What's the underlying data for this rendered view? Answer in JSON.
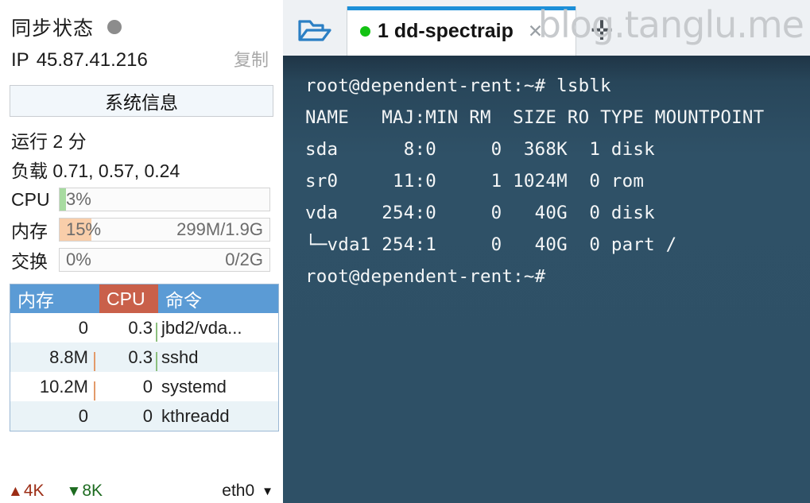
{
  "sidebar": {
    "sync": {
      "label": "同步状态",
      "status_color": "#8c8c8c",
      "indicator_name": "sync-status-dot"
    },
    "ip": {
      "label": "IP",
      "value": "45.87.41.216",
      "copy_label": "复制"
    },
    "sysinfo_button": "系统信息",
    "uptime": "运行 2 分",
    "load": "负载 0.71, 0.57, 0.24",
    "meters": [
      {
        "label": "CPU",
        "percent": "3%",
        "fill_ratio": 3,
        "detail": "",
        "fill_color": "#a7dba0"
      },
      {
        "label": "内存",
        "percent": "15%",
        "fill_ratio": 15,
        "detail": "299M/1.9G",
        "fill_color": "#f9ceaa"
      },
      {
        "label": "交换",
        "percent": "0%",
        "fill_ratio": 0,
        "detail": "0/2G",
        "fill_color": "#f9ceaa"
      }
    ],
    "process_table": {
      "header_color": "#5b9bd5",
      "cpu_header_color": "#c9604a",
      "columns": [
        "内存",
        "CPU",
        "命令"
      ],
      "rows": [
        {
          "mem": "0",
          "cpu": "0.3",
          "cmd": "jbd2/vda...",
          "mem_tick": false,
          "cpu_tick": true
        },
        {
          "mem": "8.8M",
          "cpu": "0.3",
          "cmd": "sshd",
          "mem_tick": true,
          "cpu_tick": true
        },
        {
          "mem": "10.2M",
          "cpu": "0",
          "cmd": "systemd",
          "mem_tick": true,
          "cpu_tick": false
        },
        {
          "mem": "0",
          "cpu": "0",
          "cmd": "kthreadd",
          "mem_tick": false,
          "cpu_tick": false
        }
      ]
    },
    "network": {
      "up_glyph": "▲",
      "up_value": "4K",
      "up_color": "#9c2d15",
      "down_glyph": "▼",
      "down_value": "8K",
      "down_color": "#1d6b20",
      "interface": "eth0",
      "caret_glyph": "▼"
    }
  },
  "terminal_pane": {
    "watermark": "blog.tanglu.me",
    "tabbar": {
      "folder_icon_name": "open-folder-icon",
      "tab": {
        "index": "1",
        "title": "1 dd-spectraip",
        "status_dot_color": "#13c213",
        "close_glyph": "✕",
        "accent_color": "#1c8fd8"
      },
      "new_tab_glyph": "✛"
    },
    "background_color": "#2f5167",
    "lines": [
      "root@dependent-rent:~# lsblk",
      "NAME   MAJ:MIN RM  SIZE RO TYPE MOUNTPOINT",
      "sda      8:0     0  368K  1 disk ",
      "sr0     11:0     1 1024M  0 rom  ",
      "vda    254:0     0   40G  0 disk ",
      "└─vda1 254:1     0   40G  0 part /",
      "root@dependent-rent:~#"
    ]
  }
}
